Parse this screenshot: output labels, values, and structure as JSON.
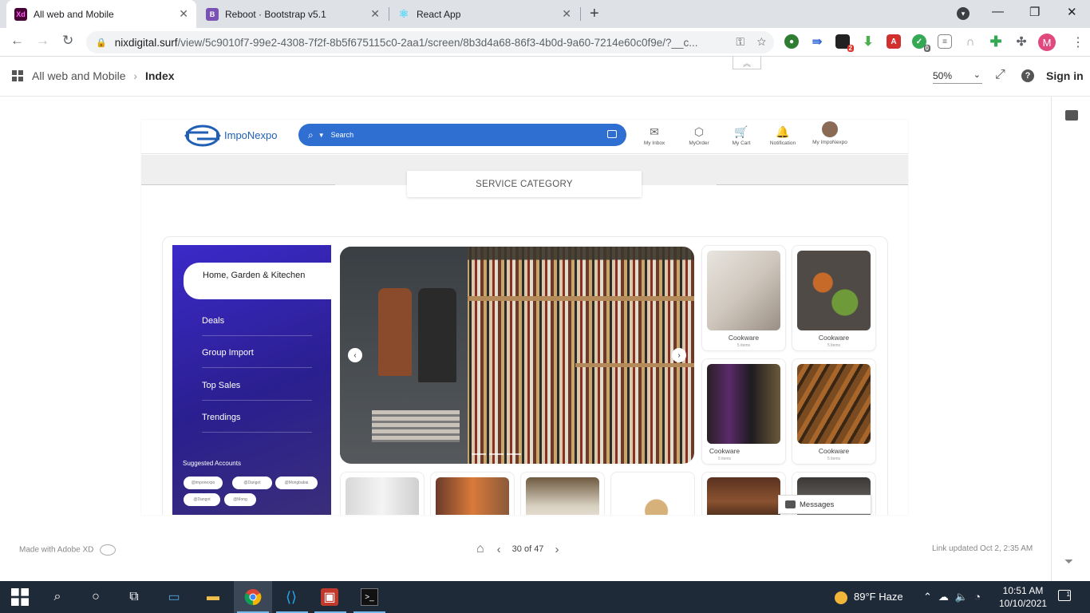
{
  "browser": {
    "tabs": [
      {
        "title": "All web and Mobile",
        "favicon": "Xd",
        "active": true
      },
      {
        "title": "Reboot · Bootstrap v5.1",
        "favicon": "B",
        "active": false
      },
      {
        "title": "React App",
        "favicon": "react-icon",
        "active": false
      }
    ],
    "url_host": "nixdigital.surf",
    "url_path": "/view/5c9010f7-99e2-4308-7f2f-8b5f675115c0-2aa1/screen/8b3d4a68-86f3-4b0d-9a60-7214e60c0f9e/?__c...",
    "ext_badge_2": "2",
    "ext_badge_0": "0",
    "profile_initial": "M"
  },
  "xd": {
    "breadcrumb_parent": "All web and Mobile",
    "breadcrumb_current": "Index",
    "zoom": "50%",
    "sign_in": "Sign in",
    "made_with": "Made with Adobe XD",
    "pager": "30 of 47",
    "link_updated": "Link updated Oct 2, 2:35 AM"
  },
  "site": {
    "brand": "ImpoNexpo",
    "search_placeholder": "Search",
    "nav": [
      {
        "label": "My Inbox",
        "icon": "mail-icon"
      },
      {
        "label": "MyOrder",
        "icon": "box-icon"
      },
      {
        "label": "My Cart",
        "icon": "cart-icon"
      },
      {
        "label": "Notification",
        "icon": "bell-icon"
      },
      {
        "label": "My ImpoNexpo",
        "icon": "user-avatar"
      }
    ],
    "service_category": "SERVICE CATEGORY",
    "sidenav_active": "Home, Garden & Kitechen",
    "sidenav_items": [
      "Deals",
      "Group Import",
      "Top Sales",
      "Trendings"
    ],
    "suggested_title": "Suggested Accounts",
    "suggested_chips": [
      "@imponexpo",
      "@Dangot",
      "@Mongbabai",
      "@Dangot",
      "@Mong"
    ],
    "cards": [
      {
        "title": "Cookware",
        "sub": "5 items"
      },
      {
        "title": "Cookware",
        "sub": "5 items"
      },
      {
        "title": "Cookware",
        "sub": "5 items"
      },
      {
        "title": "Cookware",
        "sub": "5 items"
      }
    ],
    "messages": "Messages"
  },
  "taskbar": {
    "weather": "89°F  Haze",
    "time": "10:51 AM",
    "date": "10/10/2021",
    "notif_count": "1"
  }
}
